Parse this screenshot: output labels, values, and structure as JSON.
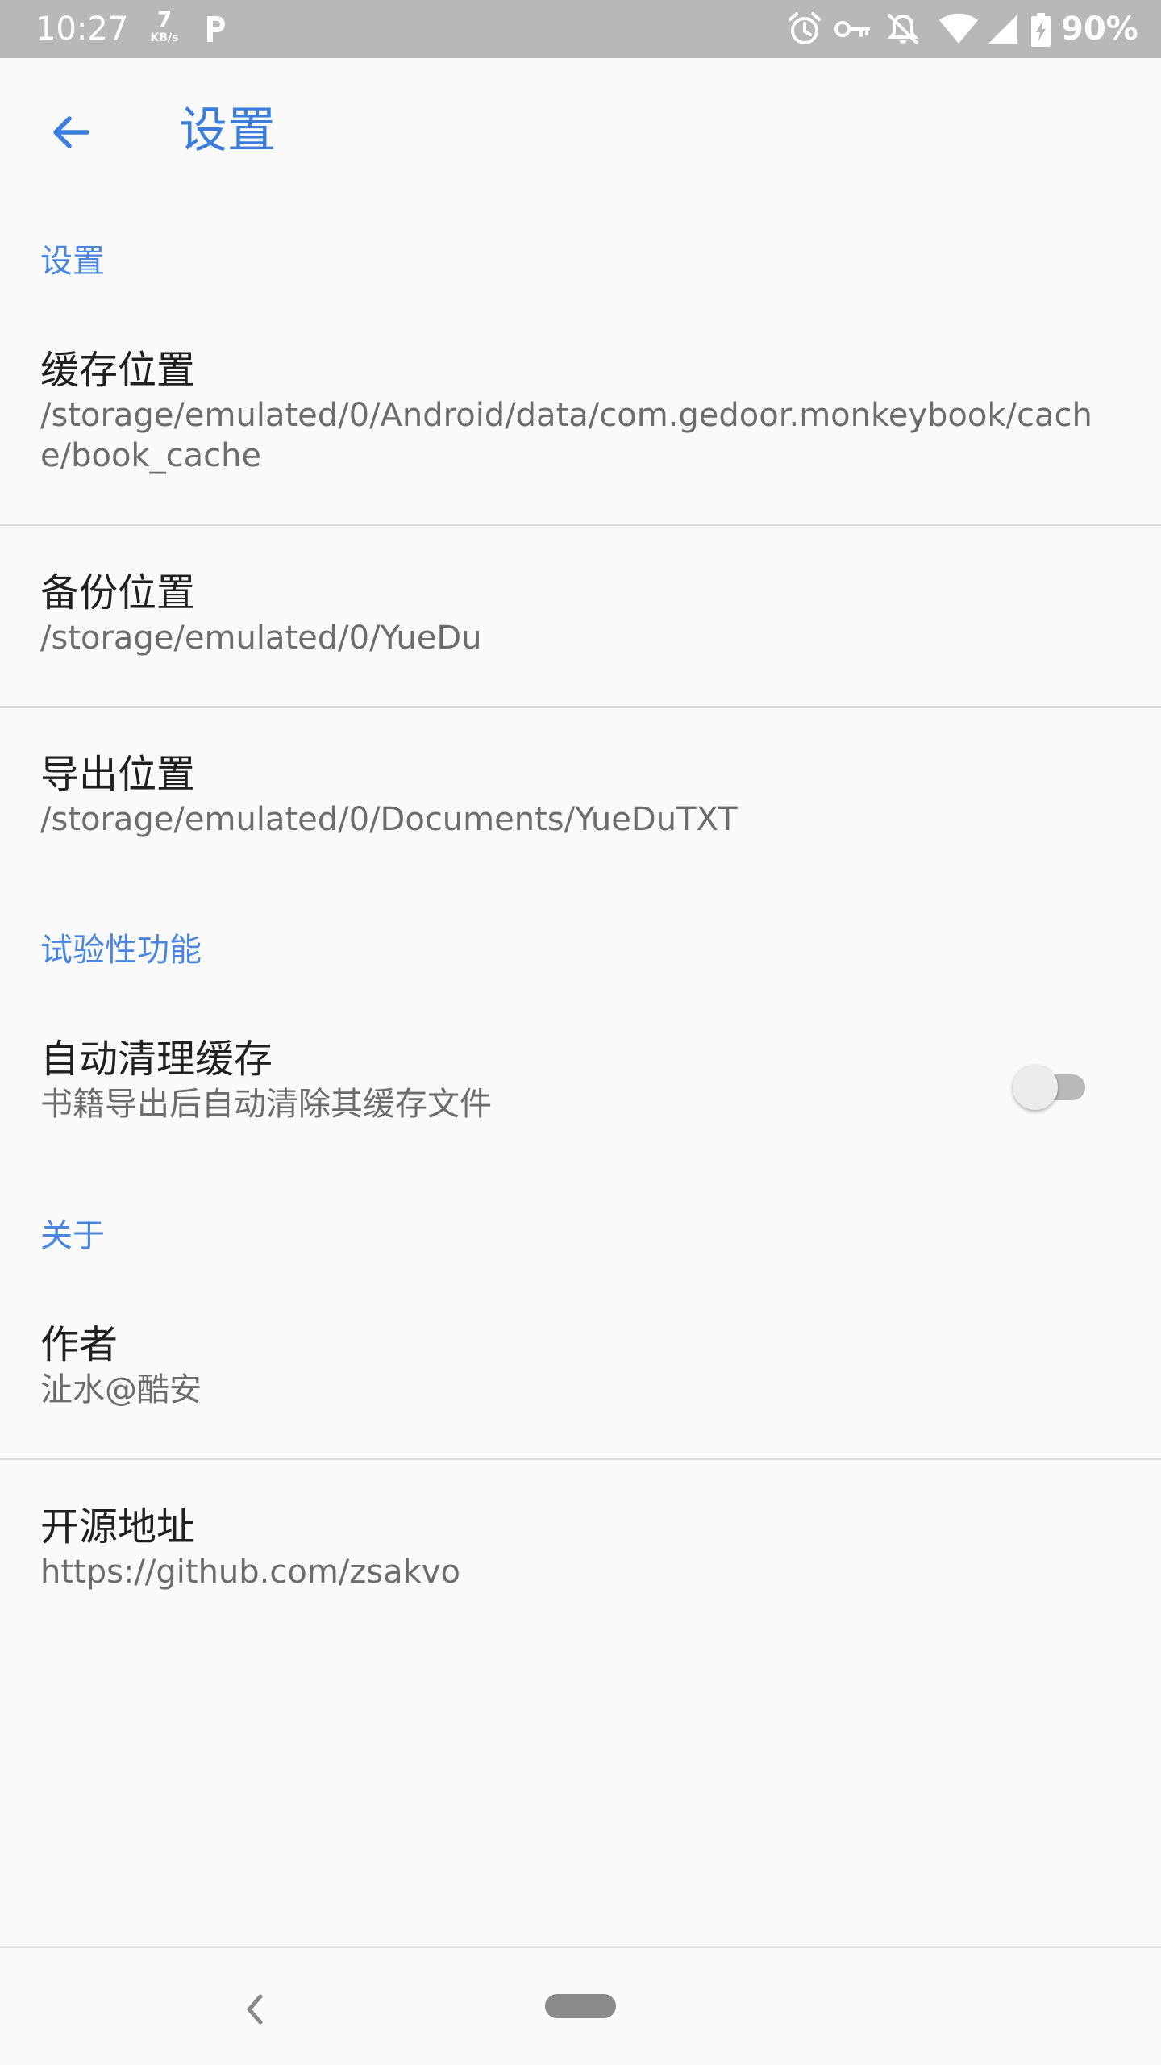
{
  "status_bar": {
    "time": "10:27",
    "net_speed_value": "7",
    "net_speed_unit": "KB/s",
    "battery": "90%",
    "icons": [
      "p-icon",
      "alarm-icon",
      "vpn-key-icon",
      "notifications-off-icon",
      "wifi-icon",
      "signal-icon",
      "battery-charging-icon"
    ]
  },
  "toolbar": {
    "title": "设置",
    "back_icon": "arrow-left-icon"
  },
  "sections": {
    "settings": {
      "header": "设置",
      "cache_location": {
        "title": "缓存位置",
        "summary": "/storage/emulated/0/Android/data/com.gedoor.monkeybook/cache/book_cache"
      },
      "backup_location": {
        "title": "备份位置",
        "summary": "/storage/emulated/0/YueDu"
      },
      "export_location": {
        "title": "导出位置",
        "summary": "/storage/emulated/0/Documents/YueDuTXT"
      }
    },
    "experimental": {
      "header": "试验性功能",
      "auto_clean_cache": {
        "title": "自动清理缓存",
        "summary": "书籍导出后自动清除其缓存文件",
        "enabled": false
      }
    },
    "about": {
      "header": "关于",
      "author": {
        "title": "作者",
        "summary": "沚水@酷安"
      },
      "source": {
        "title": "开源地址",
        "summary": "https://github.com/zsakvo"
      }
    }
  },
  "nav_bar": {
    "back_icon": "chevron-left-icon",
    "home_icon": "home-pill-icon"
  },
  "colors": {
    "accent": "#4a86e0",
    "status_bar_bg": "#b8b8b8",
    "background": "#fafafa",
    "divider": "#dcdcdc"
  }
}
